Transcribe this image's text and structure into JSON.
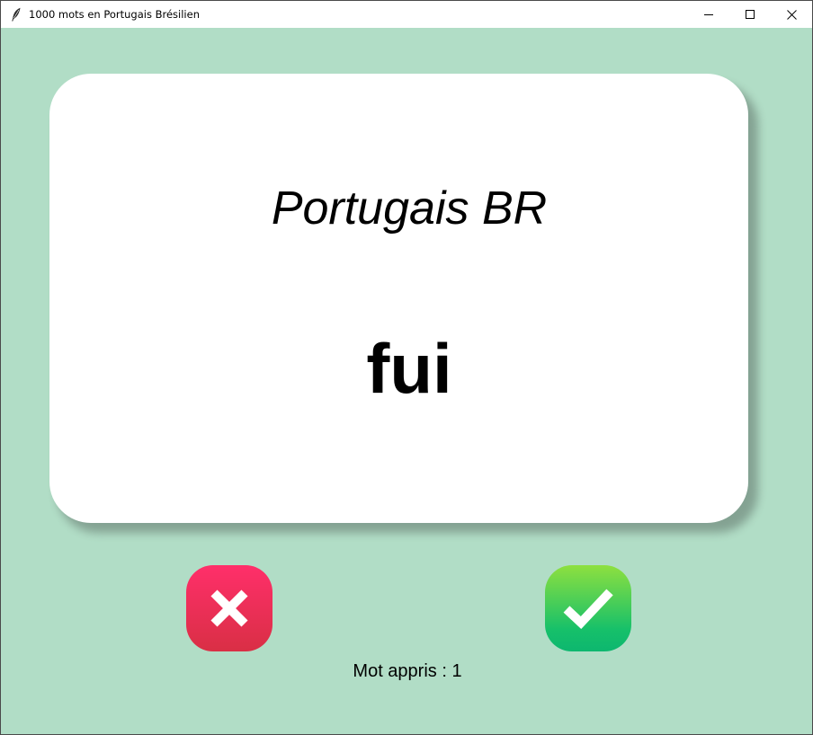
{
  "window": {
    "title": "1000 mots en Portugais Brésilien",
    "icon": "feather-icon",
    "controls": [
      "minimize-icon",
      "maximize-icon",
      "close-icon"
    ]
  },
  "card": {
    "language": "Portugais BR",
    "word": "fui"
  },
  "buttons": {
    "wrong_icon": "cross-icon",
    "right_icon": "checkmark-icon"
  },
  "status": {
    "score_text": "Mot appris : 1"
  },
  "colors": {
    "background": "#b1ddc6",
    "card": "#ffffff",
    "wrong_button": "#e8334f",
    "right_button": "#2ecb5e"
  }
}
